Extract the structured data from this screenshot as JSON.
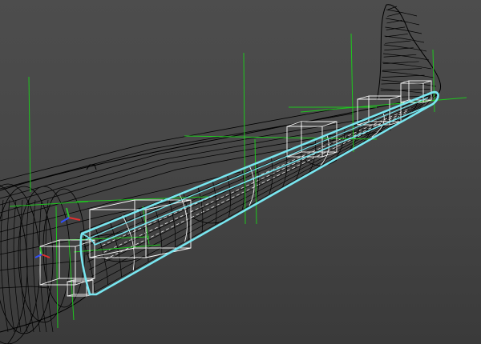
{
  "viewport": {
    "colors": {
      "background_top": "#4d4d4d",
      "background_bottom": "#3a3a3a",
      "wireframe": "#000000",
      "selection": "#78e6f0",
      "gizmo_box": "#ffffff",
      "gizmo_axis": "#1ec81e",
      "axis_x": "#e03030",
      "axis_y": "#30c030",
      "axis_z": "#3050ff"
    },
    "objects": [
      {
        "id": "fuselage",
        "kind": "wireframe-mesh",
        "selected": false
      },
      {
        "id": "tail-fin",
        "kind": "wireframe-mesh",
        "selected": false
      },
      {
        "id": "wing",
        "kind": "wireframe-mesh",
        "selected": true
      },
      {
        "id": "nacelle-pods",
        "kind": "wireframe-mesh",
        "selected": false
      }
    ],
    "gizmo_axis_icons": [
      "axis-x-icon",
      "axis-y-icon",
      "axis-z-icon"
    ]
  }
}
